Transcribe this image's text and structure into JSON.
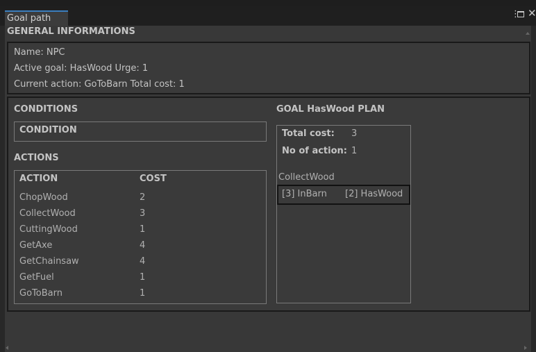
{
  "window": {
    "tab_title": "Goal path"
  },
  "general": {
    "heading": "GENERAL INFORMATIONS",
    "name_line": "Name:  NPC",
    "goal_line": "Active goal:  HasWood  Urge:  1",
    "action_line": "Current action:  GoToBarn  Total cost:  1"
  },
  "conditions": {
    "heading": "CONDITIONS",
    "column_header": "CONDITION"
  },
  "actions": {
    "heading": "ACTIONS",
    "col_action": "ACTION",
    "col_cost": "COST",
    "rows": [
      {
        "name": "ChopWood",
        "cost": "2"
      },
      {
        "name": "CollectWood",
        "cost": "3"
      },
      {
        "name": "CuttingWood",
        "cost": "1"
      },
      {
        "name": "GetAxe",
        "cost": "4"
      },
      {
        "name": "GetChainsaw",
        "cost": "4"
      },
      {
        "name": "GetFuel",
        "cost": "1"
      },
      {
        "name": "GoToBarn",
        "cost": "1"
      }
    ]
  },
  "plan": {
    "heading": "GOAL  HasWood  PLAN",
    "total_cost_label": "Total cost:",
    "total_cost_value": "3",
    "num_actions_label": "No of action:",
    "num_actions_value": "1",
    "step_name": "CollectWood",
    "step_precondition": "[3] InBarn",
    "step_effect": "[2] HasWood"
  },
  "icons": {
    "menu": "kebab-menu-icon",
    "maximize": "maximize-icon",
    "close": "close-icon"
  }
}
